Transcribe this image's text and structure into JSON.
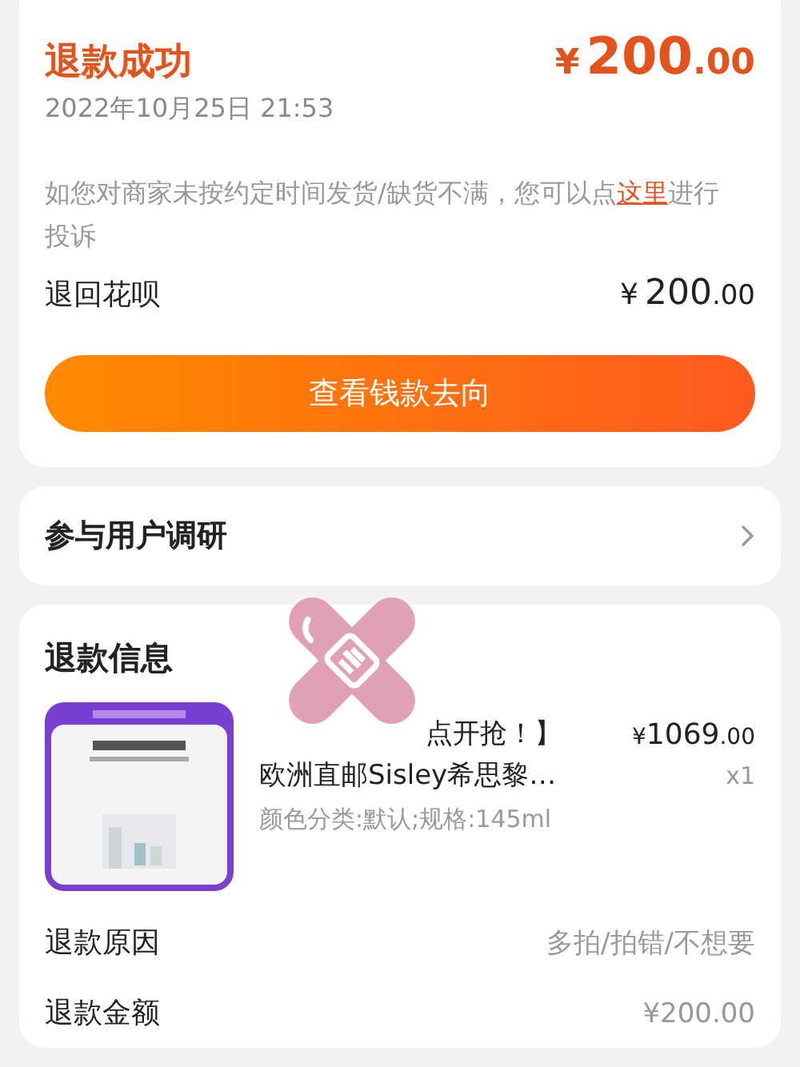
{
  "status_card": {
    "title": "退款成功",
    "amount": {
      "currency": "¥",
      "integer": "200",
      "decimal": ".00"
    },
    "time": "2022年10月25日 21:53",
    "notice": "如您对商家未按约定时间发货/缺货不满，您可以点",
    "notice_link": "这里",
    "notice_tail": "进行投诉",
    "refund_to": {
      "label": "退回花呗",
      "currency": "¥",
      "integer": "200",
      "decimal": ".00"
    },
    "button": "查看钱款去向"
  },
  "survey": {
    "label": "参与用户调研"
  },
  "refund_info": {
    "title": "退款信息",
    "product": {
      "title_visible": "点开抢！】",
      "title_line2": "欧洲直邮Sisley希思黎…",
      "spec": "颜色分类:默认;规格:145ml",
      "price": {
        "currency": "¥",
        "integer": "1069",
        "decimal": ".00"
      },
      "quantity": "x1"
    },
    "rows": [
      {
        "label": "退款原因",
        "value": "多拍/拍错/不想要"
      },
      {
        "label": "退款金额",
        "value": "¥200.00"
      }
    ]
  }
}
